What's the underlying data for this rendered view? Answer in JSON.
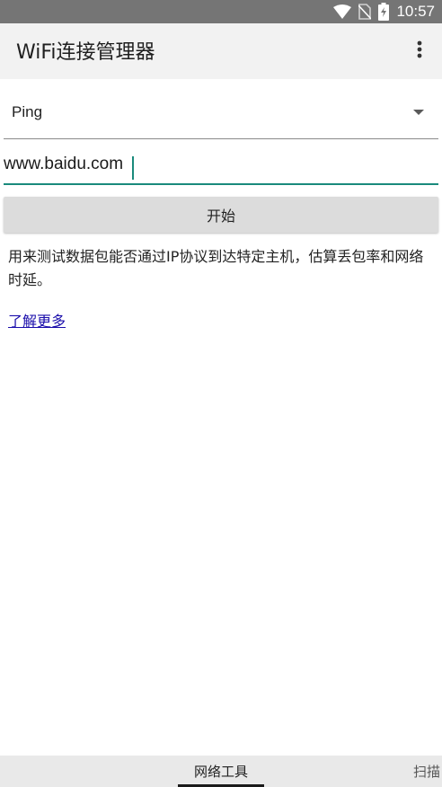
{
  "status_bar": {
    "time": "10:57",
    "icons": [
      "wifi-icon",
      "no-sim-icon",
      "battery-charging-icon"
    ]
  },
  "app_bar": {
    "title": "WiFi连接管理器",
    "menu_icon": "more-vert-icon"
  },
  "ping_tool": {
    "type_selected": "Ping",
    "host_value": "www.baidu.com",
    "start_label": "开始",
    "description": "用来测试数据包能否通过IP协议到达特定主机，估算丢包率和网络时延。",
    "learn_more_label": "了解更多"
  },
  "bottom_tabs": {
    "items": [
      {
        "label": "网络工具",
        "selected": true
      },
      {
        "label": "扫描",
        "selected": false
      }
    ]
  },
  "colors": {
    "status_bar": "#757575",
    "app_bar": "#f2f2f2",
    "accent": "#1a8a7c",
    "link": "#1a0dab",
    "button": "#dcdcdc"
  }
}
